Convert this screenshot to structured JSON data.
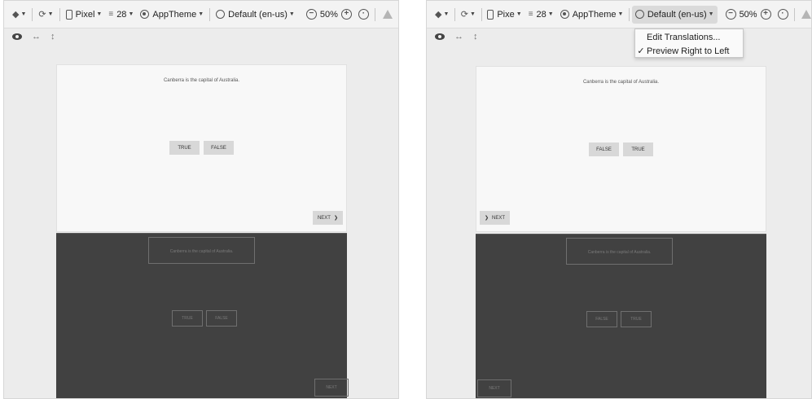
{
  "left": {
    "toolbar": {
      "device": "Pixel",
      "api": "28",
      "theme": "AppTheme",
      "locale": "Default (en-us)",
      "zoom": "50%"
    },
    "preview": {
      "question": "Canberra is the capital of Australia.",
      "buttons": [
        "TRUE",
        "FALSE"
      ],
      "next": "NEXT",
      "next_arrow": "❯"
    },
    "blueprint": {
      "question": "Canberra is the capital of Australia.",
      "buttons": [
        "TRUE",
        "FALSE"
      ],
      "next": "NEXT"
    }
  },
  "right": {
    "toolbar": {
      "device": "Pixe",
      "api": "28",
      "theme": "AppTheme",
      "locale": "Default (en-us)",
      "zoom": "50%"
    },
    "locale_menu": {
      "items": [
        {
          "label": "Edit Translations...",
          "checked": false
        },
        {
          "label": "Preview Right to Left",
          "checked": true
        }
      ],
      "check_glyph": "✓"
    },
    "preview": {
      "question": "Canberra is the capital of Australia.",
      "buttons": [
        "FALSE",
        "TRUE"
      ],
      "next": "NEXT",
      "next_arrow": "❯"
    },
    "blueprint": {
      "question": "Canberra is the capital of Australia.",
      "buttons": [
        "FALSE",
        "TRUE"
      ],
      "next": "NEXT"
    }
  },
  "icons": {
    "layers": "layers-icon",
    "orientation": "orientation-icon",
    "device": "phone-icon",
    "api": "api-level-icon",
    "theme": "theme-icon",
    "locale": "globe-icon",
    "zoom_out": "zoom-out-icon",
    "zoom_in": "zoom-in-icon",
    "zoom_fit": "zoom-fit-icon",
    "warning": "warning-icon",
    "eye": "eye-icon",
    "h_resize": "horizontal-resize-icon",
    "v_resize": "vertical-resize-icon"
  }
}
